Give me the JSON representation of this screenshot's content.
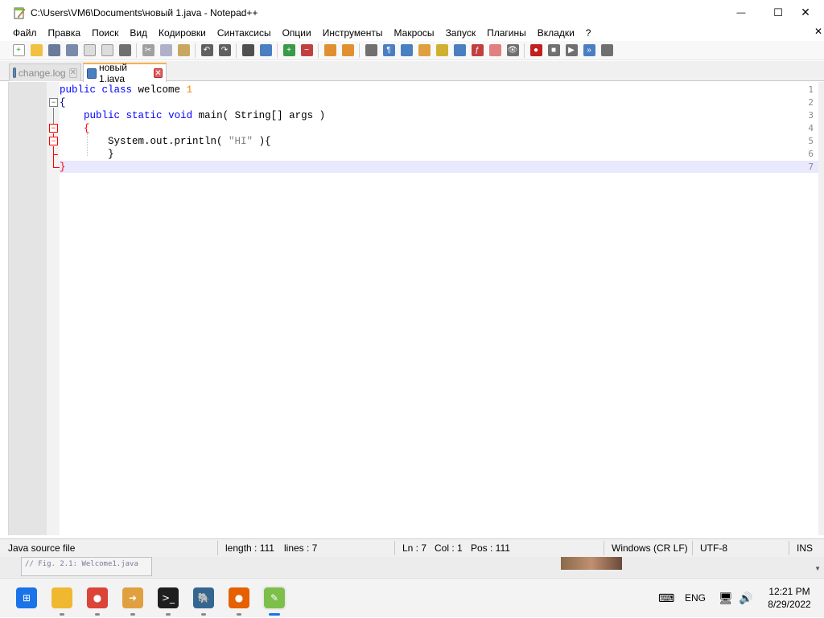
{
  "window": {
    "title": "C:\\Users\\VM6\\Documents\\новый 1.java - Notepad++",
    "app_icon": "notepadpp-icon",
    "controls": {
      "minimize": "—",
      "maximize": "☐",
      "close": "✕"
    }
  },
  "menubar": {
    "items": [
      "Файл",
      "Правка",
      "Поиск",
      "Вид",
      "Кодировки",
      "Синтаксисы",
      "Опции",
      "Инструменты",
      "Макросы",
      "Запуск",
      "Плагины",
      "Вкладки",
      "?"
    ],
    "close_glyph": "✕"
  },
  "toolbar": {
    "buttons": [
      {
        "icon": "new-file-icon",
        "color": "#ffffff",
        "glyph": "+"
      },
      {
        "icon": "open-file-icon",
        "color": "#f0c040",
        "glyph": ""
      },
      {
        "icon": "save-icon",
        "color": "#6a7a9a",
        "glyph": ""
      },
      {
        "icon": "save-all-icon",
        "color": "#7a8aaa",
        "glyph": ""
      },
      {
        "icon": "close-file-icon",
        "color": "#dcdcdc",
        "glyph": ""
      },
      {
        "icon": "close-all-icon",
        "color": "#dcdcdc",
        "glyph": ""
      },
      {
        "icon": "print-icon",
        "color": "#707070",
        "glyph": ""
      },
      {
        "sep": true
      },
      {
        "icon": "cut-icon",
        "color": "#a0a0a0",
        "glyph": "✂"
      },
      {
        "icon": "copy-icon",
        "color": "#b0b0c8",
        "glyph": ""
      },
      {
        "icon": "paste-icon",
        "color": "#c8a860",
        "glyph": ""
      },
      {
        "sep": true
      },
      {
        "icon": "undo-icon",
        "color": "#606060",
        "glyph": "↶"
      },
      {
        "icon": "redo-icon",
        "color": "#606060",
        "glyph": "↷"
      },
      {
        "sep": true
      },
      {
        "icon": "find-icon",
        "color": "#505050",
        "glyph": ""
      },
      {
        "icon": "replace-icon",
        "color": "#4a7fc1",
        "glyph": ""
      },
      {
        "sep": true
      },
      {
        "icon": "zoom-in-icon",
        "color": "#3a9a4a",
        "glyph": "+"
      },
      {
        "icon": "zoom-out-icon",
        "color": "#c04040",
        "glyph": "−"
      },
      {
        "sep": true
      },
      {
        "icon": "sync-vertical-icon",
        "color": "#e09030",
        "glyph": ""
      },
      {
        "icon": "sync-horizontal-icon",
        "color": "#e09030",
        "glyph": ""
      },
      {
        "sep": true
      },
      {
        "icon": "word-wrap-icon",
        "color": "#707070",
        "glyph": ""
      },
      {
        "icon": "show-all-chars-icon",
        "color": "#4a7fc1",
        "glyph": "¶"
      },
      {
        "icon": "indent-guide-icon",
        "color": "#4a7fc1",
        "glyph": ""
      },
      {
        "icon": "udl-icon",
        "color": "#e0a040",
        "glyph": ""
      },
      {
        "icon": "doc-map-icon",
        "color": "#d0b030",
        "glyph": ""
      },
      {
        "icon": "doc-list-icon",
        "color": "#4a7fc1",
        "glyph": ""
      },
      {
        "icon": "function-list-icon",
        "color": "#c04040",
        "glyph": "ƒ"
      },
      {
        "icon": "folder-workspace-icon",
        "color": "#e08080",
        "glyph": ""
      },
      {
        "icon": "monitoring-icon",
        "color": "#707070",
        "glyph": "👁"
      },
      {
        "sep": true
      },
      {
        "icon": "record-macro-icon",
        "color": "#c02020",
        "glyph": "●"
      },
      {
        "icon": "stop-macro-icon",
        "color": "#707070",
        "glyph": "■"
      },
      {
        "icon": "play-macro-icon",
        "color": "#707070",
        "glyph": "▶"
      },
      {
        "icon": "run-macro-multiple-icon",
        "color": "#4a7fc1",
        "glyph": "»"
      },
      {
        "icon": "save-macro-icon",
        "color": "#707070",
        "glyph": ""
      }
    ]
  },
  "tabs": [
    {
      "label": "change.log",
      "active": false
    },
    {
      "label": "новый 1.java",
      "active": true
    }
  ],
  "editor": {
    "line_numbers": [
      "1",
      "2",
      "3",
      "4",
      "5",
      "6",
      "7"
    ],
    "lines": [
      [
        {
          "t": "public",
          "c": "kw"
        },
        {
          "t": " "
        },
        {
          "t": "class",
          "c": "kw"
        },
        {
          "t": " welcome "
        },
        {
          "t": "1",
          "c": "num"
        }
      ],
      [
        {
          "t": "{",
          "c": "op"
        }
      ],
      [
        {
          "t": "    "
        },
        {
          "t": "public",
          "c": "kw"
        },
        {
          "t": " "
        },
        {
          "t": "static",
          "c": "kw"
        },
        {
          "t": " "
        },
        {
          "t": "void",
          "c": "kw"
        },
        {
          "t": " main( String[] args )"
        }
      ],
      [
        {
          "t": "    "
        },
        {
          "t": "{",
          "c": "brace-red"
        }
      ],
      [
        {
          "t": "        System.out.println( "
        },
        {
          "t": "\"HI\"",
          "c": "str"
        },
        {
          "t": " ){"
        }
      ],
      [
        {
          "t": "        }"
        }
      ],
      [
        {
          "t": "}",
          "c": "brace-red"
        }
      ]
    ],
    "current_line": 7
  },
  "statusbar": {
    "file_type": "Java source file",
    "length": "length : 111",
    "lines": "lines : 7",
    "ln": "Ln : 7",
    "col": "Col : 1",
    "pos": "Pos : 111",
    "eol": "Windows (CR LF)",
    "encoding": "UTF-8",
    "mode": "INS"
  },
  "background_window": {
    "snippet_text": "// Fig. 2.1: Welcome1.java"
  },
  "taskbar": {
    "apps": [
      {
        "icon": "windows-start-icon",
        "color": "#1a73e8",
        "glyph": "⊞",
        "dot": false
      },
      {
        "icon": "file-explorer-icon",
        "color": "#f0b830",
        "glyph": "",
        "dot": true
      },
      {
        "icon": "chrome-icon",
        "color": "#db4437",
        "glyph": "●",
        "dot": true
      },
      {
        "icon": "move-app-icon",
        "color": "#e0a040",
        "glyph": "➜",
        "dot": true
      },
      {
        "icon": "command-prompt-icon",
        "color": "#1e1e1e",
        "glyph": ">_",
        "dot": true
      },
      {
        "icon": "postgresql-icon",
        "color": "#336791",
        "glyph": "🐘",
        "dot": true
      },
      {
        "icon": "firefox-icon",
        "color": "#e66000",
        "glyph": "●",
        "dot": true
      },
      {
        "icon": "notepadpp-taskbar-icon",
        "color": "#7cbf4a",
        "glyph": "✎",
        "dot": true,
        "active": true
      }
    ],
    "tray": {
      "keyboard_icon": "keyboard-icon",
      "language": "ENG",
      "network_icon": "network-icon",
      "volume_icon": "volume-icon",
      "time": "12:21 PM",
      "date": "8/29/2022"
    }
  }
}
